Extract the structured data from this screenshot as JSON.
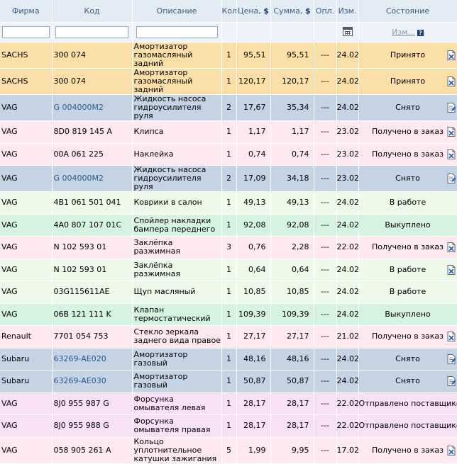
{
  "headers": {
    "firm": "Фирма",
    "code": "Код",
    "desc": "Описание",
    "qty": "Кол",
    "price": "Цена,",
    "sum": "Сумма,",
    "currency": "$",
    "paid": "Опл.",
    "date": "Изм.",
    "state": "Состояние"
  },
  "filters": {
    "state_link": "Изм...",
    "help": "?"
  },
  "colors": {
    "accepted": "#fbdfa9",
    "removed": "#c5d4e4",
    "received": "#fde9ef",
    "work": "#edf9e9",
    "bought": "#d6f3e2",
    "sent": "#f8e1f6",
    "header": "#e3ebf5",
    "link": "#2d5590"
  },
  "rows": [
    {
      "firm": "SACHS",
      "code": "300 074",
      "code_link": false,
      "desc": "Амортизатор газомасляный задний",
      "qty": "1",
      "price": "95,51",
      "sum": "95,51",
      "paid": "---",
      "date": "24.02",
      "state": "Принято",
      "status": "accepted",
      "icon": "cancel-order-icon"
    },
    {
      "firm": "SACHS",
      "code": "300 074",
      "code_link": false,
      "desc": "Амортизатор газомасляный задний",
      "qty": "1",
      "price": "120,17",
      "sum": "120,17",
      "paid": "---",
      "date": "24.02",
      "state": "Принято",
      "status": "accepted",
      "icon": "cancel-order-icon"
    },
    {
      "firm": "VAG",
      "code": "G 004000M2",
      "code_link": true,
      "desc": "Жидкость насоса гидроусилителя руля",
      "qty": "2",
      "price": "17,67",
      "sum": "35,34",
      "paid": "---",
      "date": "24.02",
      "state": "Снято",
      "status": "removed",
      "icon": "edit-order-icon"
    },
    {
      "firm": "VAG",
      "code": "8D0 819 145 A",
      "code_link": false,
      "desc": "Клипса",
      "qty": "1",
      "price": "1,17",
      "sum": "1,17",
      "paid": "---",
      "date": "23.02",
      "state": "Получено в заказ",
      "status": "received",
      "icon": "cancel-order-icon"
    },
    {
      "firm": "VAG",
      "code": "00A 061 225",
      "code_link": false,
      "desc": "Наклейка",
      "qty": "1",
      "price": "0,74",
      "sum": "0,74",
      "paid": "---",
      "date": "23.02",
      "state": "Получено в заказ",
      "status": "received",
      "icon": "cancel-order-icon"
    },
    {
      "firm": "VAG",
      "code": "G 004000M2",
      "code_link": true,
      "desc": "Жидкость насоса гидроусилителя руля",
      "qty": "2",
      "price": "17,09",
      "sum": "34,18",
      "paid": "---",
      "date": "23.02",
      "state": "Снято",
      "status": "removed",
      "icon": "edit-order-icon"
    },
    {
      "firm": "VAG",
      "code": "4B1 061 501 041",
      "code_link": false,
      "desc": "Коврики в салон",
      "qty": "1",
      "price": "49,13",
      "sum": "49,13",
      "paid": "---",
      "date": "24.02",
      "state": "В работе",
      "status": "work",
      "icon": ""
    },
    {
      "firm": "VAG",
      "code": "4A0 807 107 01C",
      "code_link": false,
      "desc": "Спойлер накладки бампера переднего",
      "qty": "1",
      "price": "92,08",
      "sum": "92,08",
      "paid": "---",
      "date": "24.02",
      "state": "Выкуплено",
      "status": "bought",
      "icon": ""
    },
    {
      "firm": "VAG",
      "code": "N 102 593 01",
      "code_link": false,
      "desc": "Заклёпка разжимная",
      "qty": "3",
      "price": "0,76",
      "sum": "2,28",
      "paid": "---",
      "date": "22.02",
      "state": "Получено в заказ",
      "status": "received",
      "icon": "cancel-order-icon"
    },
    {
      "firm": "VAG",
      "code": "N 102 593 01",
      "code_link": false,
      "desc": "Заклёпка разжимная",
      "qty": "1",
      "price": "0,64",
      "sum": "0,64",
      "paid": "---",
      "date": "24.02",
      "state": "В работе",
      "status": "work",
      "icon": "cancel-order-icon"
    },
    {
      "firm": "VAG",
      "code": "03G115611AE",
      "code_link": false,
      "desc": "Щуп масляный",
      "qty": "1",
      "price": "10,85",
      "sum": "10,85",
      "paid": "---",
      "date": "24.02",
      "state": "В работе",
      "status": "work",
      "icon": ""
    },
    {
      "firm": "VAG",
      "code": "06B 121 111 K",
      "code_link": false,
      "desc": "Клапан термостатический",
      "qty": "1",
      "price": "109,39",
      "sum": "109,39",
      "paid": "---",
      "date": "24.02",
      "state": "Выкуплено",
      "status": "bought",
      "icon": ""
    },
    {
      "firm": "Renault",
      "code": "7701 054 753",
      "code_link": false,
      "desc": "Стекло зеркала заднего вида правое",
      "qty": "1",
      "price": "27,17",
      "sum": "27,17",
      "paid": "---",
      "date": "21.02",
      "state": "Получено в заказ",
      "status": "received",
      "icon": "cancel-order-icon"
    },
    {
      "firm": "Subaru",
      "code": "63269-AE020",
      "code_link": true,
      "desc": "Амортизатор газовый",
      "qty": "1",
      "price": "48,16",
      "sum": "48,16",
      "paid": "---",
      "date": "24.02",
      "state": "Снято",
      "status": "removed",
      "icon": "edit-order-icon"
    },
    {
      "firm": "Subaru",
      "code": "63269-AE030",
      "code_link": true,
      "desc": "Амортизатор газовый",
      "qty": "1",
      "price": "50,87",
      "sum": "50,87",
      "paid": "---",
      "date": "24.02",
      "state": "Снято",
      "status": "removed",
      "icon": "edit-order-icon"
    },
    {
      "firm": "VAG",
      "code": "8J0 955 987 G",
      "code_link": false,
      "desc": "Форсунка омывателя левая",
      "qty": "1",
      "price": "28,17",
      "sum": "28,17",
      "paid": "---",
      "date": "22.02",
      "state": "Отправлено поставщиком",
      "status": "sent",
      "icon": ""
    },
    {
      "firm": "VAG",
      "code": "8J0 955 988 G",
      "code_link": false,
      "desc": "Форсунка омывателя правая",
      "qty": "1",
      "price": "28,17",
      "sum": "28,17",
      "paid": "---",
      "date": "22.02",
      "state": "Отправлено поставщиком",
      "status": "sent",
      "icon": ""
    },
    {
      "firm": "VAG",
      "code": "058 905 261 A",
      "code_link": false,
      "desc": "Кольцо уплотнительное катушки зажигания",
      "qty": "5",
      "price": "1,99",
      "sum": "9,95",
      "paid": "---",
      "date": "17.02",
      "state": "Получено в заказ",
      "status": "received",
      "icon": "cancel-order-icon"
    }
  ]
}
